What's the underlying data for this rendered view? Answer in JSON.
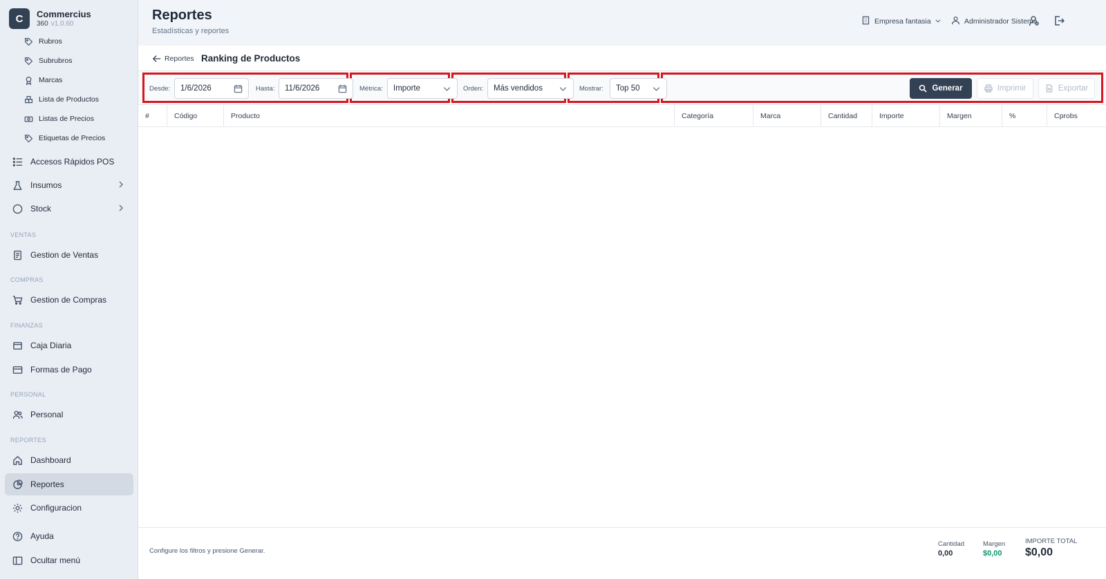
{
  "brand": {
    "letter": "C",
    "name": "Commercius",
    "product": "360",
    "version": "v1.0.60"
  },
  "sidebar": {
    "sub_items": [
      {
        "label": "Rubros",
        "icon": "tag-icon"
      },
      {
        "label": "Subrubros",
        "icon": "tag-icon"
      },
      {
        "label": "Marcas",
        "icon": "award-icon"
      },
      {
        "label": "Lista de Productos",
        "icon": "boxes-icon"
      },
      {
        "label": "Listas de Precios",
        "icon": "banknote-icon"
      },
      {
        "label": "Etiquetas de Precios",
        "icon": "tag-icon"
      }
    ],
    "items": {
      "accesos": "Accesos Rápidos POS",
      "insumos": "Insumos",
      "stock": "Stock",
      "ventas": "Gestion de Ventas",
      "compras": "Gestion de Compras",
      "caja": "Caja Diaria",
      "formas": "Formas de Pago",
      "personal": "Personal",
      "dashboard": "Dashboard",
      "reportes": "Reportes",
      "config": "Configuracion",
      "ayuda": "Ayuda",
      "ocultar": "Ocultar menú"
    },
    "sections": {
      "ventas": "VENTAS",
      "compras": "COMPRAS",
      "finanzas": "FINANZAS",
      "personal": "PERSONAL",
      "reportes": "REPORTES"
    }
  },
  "header": {
    "title": "Reportes",
    "subtitle": "Estadísticas y reportes",
    "company": "Empresa fantasia",
    "user": "Administrador Sistema"
  },
  "report": {
    "back_label": "Reportes",
    "title": "Ranking de Productos"
  },
  "filters": {
    "desde_label": "Desde:",
    "desde_value": "1/6/2026",
    "hasta_label": "Hasta:",
    "hasta_value": "11/6/2026",
    "metrica_label": "Métrica:",
    "metrica_value": "Importe",
    "orden_label": "Orden:",
    "orden_value": "Más vendidos",
    "mostrar_label": "Mostrar:",
    "mostrar_value": "Top 50"
  },
  "actions": {
    "generar": "Generar",
    "imprimir": "Imprimir",
    "exportar": "Exportar"
  },
  "table": {
    "columns": [
      "#",
      "Código",
      "Producto",
      "Categoría",
      "Marca",
      "Cantidad",
      "Importe",
      "Margen",
      "%",
      "Cprobs"
    ]
  },
  "footer": {
    "message": "Configure los filtros y presione Generar.",
    "cantidad_label": "Cantidad",
    "cantidad_value": "0,00",
    "margen_label": "Margen",
    "margen_value": "$0,00",
    "importe_label": "IMPORTE TOTAL",
    "importe_value": "$0,00"
  },
  "colors": {
    "highlight": "#d7141f",
    "primary": "#334155",
    "margin_value": "#059669"
  }
}
